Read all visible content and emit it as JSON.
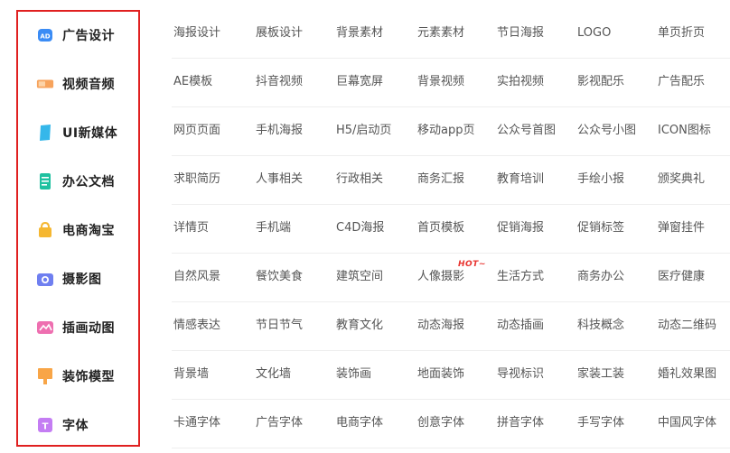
{
  "categories": [
    {
      "label": "广告设计",
      "icon": "ad-design-icon",
      "color": "#3b8cf5"
    },
    {
      "label": "视频音频",
      "icon": "video-audio-icon",
      "color": "#f7a35c"
    },
    {
      "label": "UI新媒体",
      "icon": "ui-media-icon",
      "color": "#35b7ea"
    },
    {
      "label": "办公文档",
      "icon": "office-doc-icon",
      "color": "#1fc1a0"
    },
    {
      "label": "电商淘宝",
      "icon": "ecommerce-icon",
      "color": "#f5b731"
    },
    {
      "label": "摄影图",
      "icon": "camera-icon",
      "color": "#6f7ff0"
    },
    {
      "label": "插画动图",
      "icon": "illustration-icon",
      "color": "#ee6fb0"
    },
    {
      "label": "装饰模型",
      "icon": "decoration-icon",
      "color": "#f8a547"
    },
    {
      "label": "字体",
      "icon": "font-icon",
      "color": "#c47df3"
    }
  ],
  "rows": [
    [
      "海报设计",
      "展板设计",
      "背景素材",
      "元素素材",
      "节日海报",
      "LOGO",
      "单页折页"
    ],
    [
      "AE模板",
      "抖音视频",
      "巨幕宽屏",
      "背景视频",
      "实拍视频",
      "影视配乐",
      "广告配乐"
    ],
    [
      "网页页面",
      "手机海报",
      "H5/启动页",
      "移动app页",
      "公众号首图",
      "公众号小图",
      "ICON图标"
    ],
    [
      "求职简历",
      "人事相关",
      "行政相关",
      "商务汇报",
      "教育培训",
      "手绘小报",
      "颁奖典礼"
    ],
    [
      "详情页",
      "手机端",
      "C4D海报",
      "首页模板",
      "促销海报",
      "促销标签",
      "弹窗挂件"
    ],
    [
      "自然风景",
      "餐饮美食",
      "建筑空间",
      "人像摄影",
      "生活方式",
      "商务办公",
      "医疗健康"
    ],
    [
      "情感表达",
      "节日节气",
      "教育文化",
      "动态海报",
      "动态插画",
      "科技概念",
      "动态二维码"
    ],
    [
      "背景墙",
      "文化墙",
      "装饰画",
      "地面装饰",
      "导视标识",
      "家装工装",
      "婚礼效果图"
    ],
    [
      "卡通字体",
      "广告字体",
      "电商字体",
      "创意字体",
      "拼音字体",
      "手写字体",
      "中国风字体"
    ]
  ],
  "hot_badge": "HOT~"
}
